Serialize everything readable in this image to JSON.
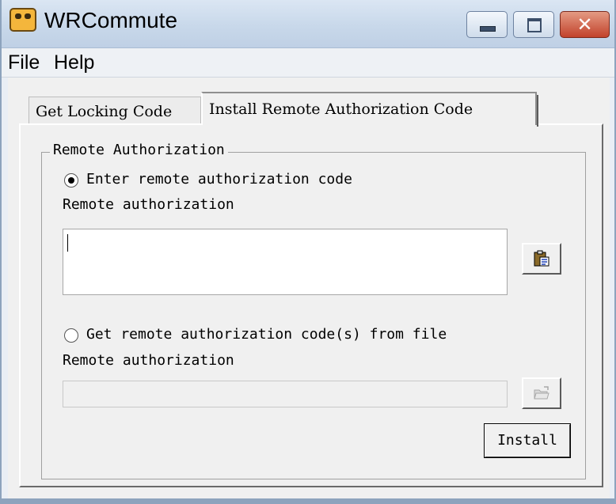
{
  "window": {
    "title": "WRCommute",
    "icon": "app-icon",
    "controls": [
      "minimize-icon",
      "maximize-icon",
      "close-icon"
    ]
  },
  "menu": {
    "items": [
      {
        "label": "File"
      },
      {
        "label": "Help"
      }
    ]
  },
  "tabs": [
    {
      "label": "Get Locking Code",
      "active": false
    },
    {
      "label": "Install Remote Authorization Code",
      "active": true
    }
  ],
  "remote_authorization": {
    "group_title": "Remote Authorization",
    "option_enter": {
      "label": "Enter remote authorization code",
      "selected": true,
      "field_label": "Remote authorization",
      "value": "",
      "paste_icon": "paste-icon"
    },
    "option_file": {
      "label": "Get remote authorization code(s) from file",
      "selected": false,
      "field_label": "Remote authorization",
      "value": "",
      "browse_icon": "open-folder-icon",
      "enabled": false
    },
    "install_button": "Install"
  }
}
